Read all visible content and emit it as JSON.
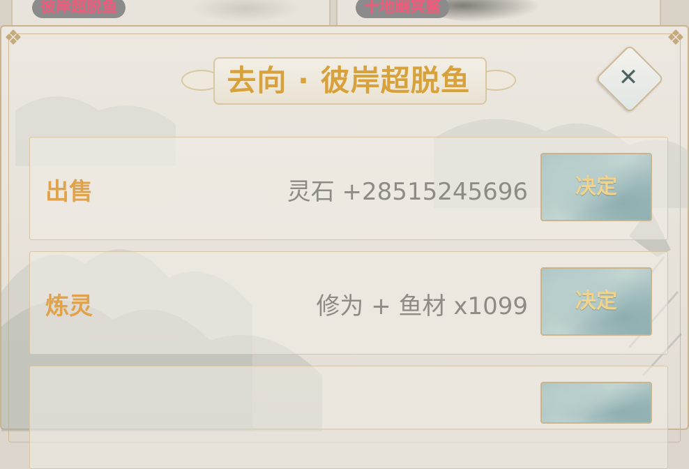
{
  "background_cards": [
    {
      "name": "彼岸超脱鱼"
    },
    {
      "name": "十地幽冥鳌"
    }
  ],
  "dialog": {
    "title": "去向 · 彼岸超脱鱼",
    "close_icon": "close-icon",
    "rows": [
      {
        "label": "出售",
        "reward": "灵石 +28515245696",
        "button": "决定"
      },
      {
        "label": "炼灵",
        "reward": "修为 + 鱼材 x1099",
        "button": "决定"
      },
      {
        "label": "",
        "reward": "",
        "button": ""
      }
    ]
  },
  "colors": {
    "title": "#d7a23d",
    "row_label": "#e0a24b",
    "reward_text": "#8e8a84",
    "button_text": "#f1d38c",
    "bg_card_name": "#f05a7a"
  }
}
